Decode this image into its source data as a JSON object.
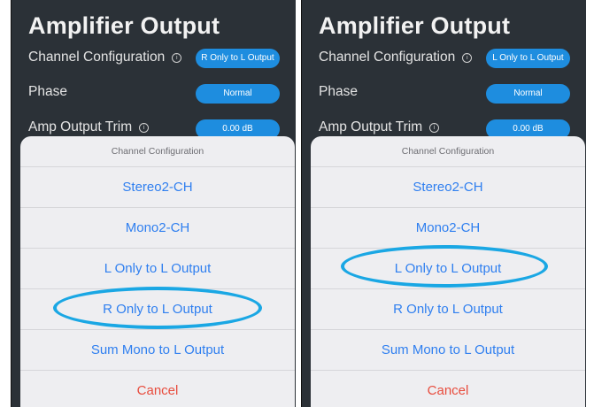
{
  "screens": [
    {
      "title": "Amplifier Output",
      "settings": [
        {
          "label": "Channel Configuration",
          "info": "i",
          "value": "R Only to L Output"
        },
        {
          "label": "Phase",
          "value": "Normal"
        },
        {
          "label": "Amp Output Trim",
          "info": "i",
          "value": "0.00 dB"
        }
      ],
      "sheet": {
        "title": "Channel Configuration",
        "options": [
          "Stereo2-CH",
          "Mono2-CH",
          "L Only to L Output",
          "R Only to L Output",
          "Sum Mono to L Output"
        ],
        "cancel": "Cancel",
        "highlighted": "R Only to L Output"
      }
    },
    {
      "title": "Amplifier Output",
      "settings": [
        {
          "label": "Channel Configuration",
          "info": "i",
          "value": "L Only to L Output"
        },
        {
          "label": "Phase",
          "value": "Normal"
        },
        {
          "label": "Amp Output Trim",
          "info": "i",
          "value": "0.00 dB"
        }
      ],
      "sheet": {
        "title": "Channel Configuration",
        "options": [
          "Stereo2-CH",
          "Mono2-CH",
          "L Only to L Output",
          "R Only to L Output",
          "Sum Mono to L Output"
        ],
        "cancel": "Cancel",
        "highlighted": "L Only to L Output"
      }
    }
  ],
  "colors": {
    "background": "#2b3137",
    "pill": "#1e8ddf",
    "option_text": "#2f7ff0",
    "cancel_text": "#e84c3d",
    "highlight_ring": "#1aa7e4"
  }
}
